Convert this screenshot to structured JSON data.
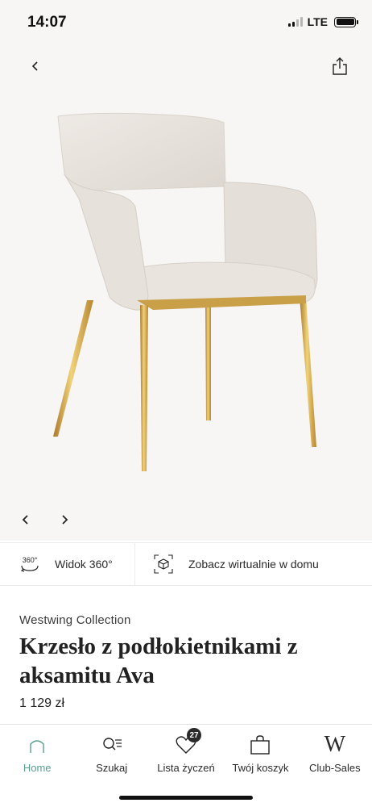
{
  "status": {
    "time": "14:07",
    "network": "LTE"
  },
  "features": {
    "view360_icon_text": "360°",
    "view360_label": "Widok 360°",
    "ar_label": "Zobacz wirtualnie w domu"
  },
  "product": {
    "brand": "Westwing Collection",
    "title": "Krzesło z podłokietnikami z aksamitu Ava",
    "price": "1 129 zł",
    "colors": {
      "upholstery": "#e7e2dc",
      "legs": "#d4a84a"
    }
  },
  "bottom_nav": {
    "home": "Home",
    "search": "Szukaj",
    "wishlist": "Lista życzeń",
    "wishlist_count": "27",
    "cart": "Twój koszyk",
    "club": "Club-Sales",
    "club_logo": "W"
  },
  "theme": {
    "accent": "#5a9e8f",
    "gallery_bg": "#f7f6f5"
  }
}
